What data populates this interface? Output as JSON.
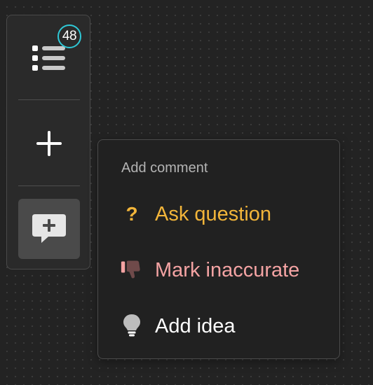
{
  "toolbar": {
    "list_badge_count": "48",
    "buttons": [
      {
        "icon": "list-icon"
      },
      {
        "icon": "plus-icon"
      },
      {
        "icon": "add-comment-icon"
      }
    ]
  },
  "comment_menu": {
    "header": "Add comment",
    "items": [
      {
        "label": "Ask question",
        "icon": "question-mark-icon",
        "color": "#f2b53a"
      },
      {
        "label": "Mark inaccurate",
        "icon": "thumbs-down-icon",
        "color": "#f4a3a3"
      },
      {
        "label": "Add idea",
        "icon": "lightbulb-icon",
        "color": "#ffffff"
      }
    ]
  },
  "colors": {
    "background": "#232323",
    "panel": "#2a2a2a",
    "menu": "#212121",
    "badge_ring": "#2fc8d6",
    "selected_button": "#4a4a4a"
  }
}
